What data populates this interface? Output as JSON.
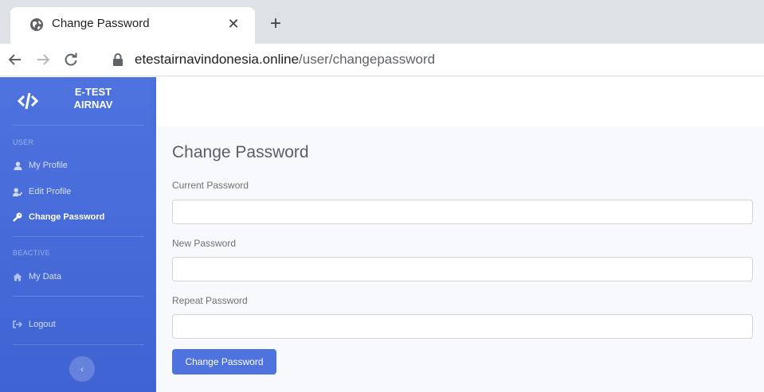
{
  "browser": {
    "tab_title": "Change Password",
    "close_glyph": "✕",
    "newtab_glyph": "+",
    "url_host": "etestairnavindonesia.online",
    "url_path": "/user/changepassword"
  },
  "sidebar": {
    "brand_line1": "E-TEST",
    "brand_line2": "AIRNAV",
    "heading_user": "USER",
    "heading_beactive": "BEACTIVE",
    "items": [
      {
        "label": "My Profile",
        "icon": "user-icon",
        "active": false
      },
      {
        "label": "Edit Profile",
        "icon": "user-edit-icon",
        "active": false
      },
      {
        "label": "Change Password",
        "icon": "key-icon",
        "active": true
      },
      {
        "label": "My Data",
        "icon": "home-icon",
        "active": false
      },
      {
        "label": "Logout",
        "icon": "sign-out-icon",
        "active": false
      }
    ],
    "toggle_glyph": "‹"
  },
  "main": {
    "title": "Change Password",
    "fields": [
      {
        "label": "Current Password",
        "value": ""
      },
      {
        "label": "New Password",
        "value": ""
      },
      {
        "label": "Repeat Password",
        "value": ""
      }
    ],
    "submit_label": "Change Password"
  },
  "colors": {
    "primary": "#4e73df",
    "sidebar_text": "#ffffff",
    "content_bg": "#f8f9fc"
  }
}
